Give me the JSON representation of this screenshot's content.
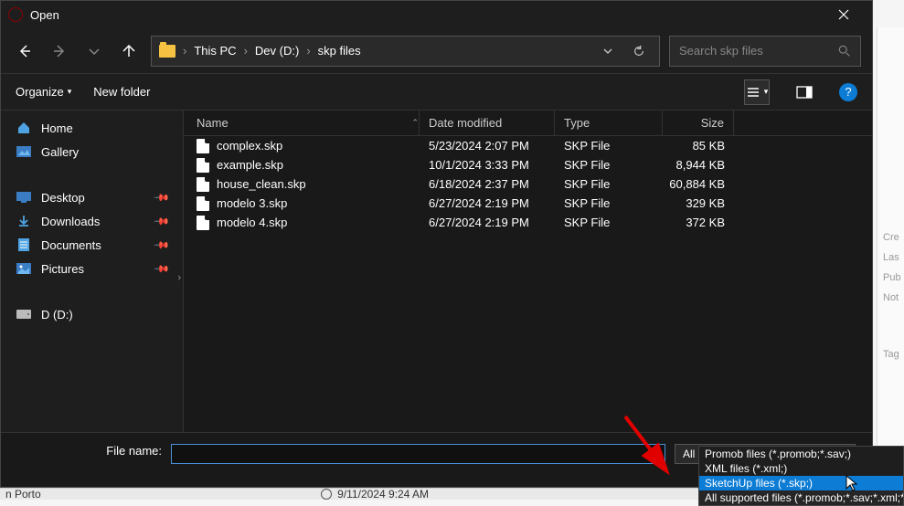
{
  "window": {
    "title": "Open"
  },
  "nav": {
    "breadcrumbs": [
      "This PC",
      "Dev (D:)",
      "skp files"
    ],
    "search_placeholder": "Search skp files"
  },
  "toolbar": {
    "organize": "Organize",
    "new_folder": "New folder"
  },
  "sidebar": {
    "home": "Home",
    "gallery": "Gallery",
    "quick": [
      {
        "label": "Desktop"
      },
      {
        "label": "Downloads"
      },
      {
        "label": "Documents"
      },
      {
        "label": "Pictures"
      }
    ],
    "drive": "D (D:)"
  },
  "columns": {
    "name": "Name",
    "date": "Date modified",
    "type": "Type",
    "size": "Size"
  },
  "files": [
    {
      "name": "complex.skp",
      "date": "5/23/2024 2:07 PM",
      "type": "SKP File",
      "size": "85 KB"
    },
    {
      "name": "example.skp",
      "date": "10/1/2024 3:33 PM",
      "type": "SKP File",
      "size": "8,944 KB"
    },
    {
      "name": "house_clean.skp",
      "date": "6/18/2024 2:37 PM",
      "type": "SKP File",
      "size": "60,884 KB"
    },
    {
      "name": "modelo 3.skp",
      "date": "6/27/2024 2:19 PM",
      "type": "SKP File",
      "size": "329 KB"
    },
    {
      "name": "modelo 4.skp",
      "date": "6/27/2024 2:19 PM",
      "type": "SKP File",
      "size": "372 KB"
    }
  ],
  "bottom": {
    "filename_label": "File name:",
    "filter_selected": "All supported files (*.promob;*.",
    "filter_options": [
      "Promob files (*.promob;*.sav;)",
      "XML files (*.xml;)",
      "SketchUp files (*.skp;)",
      "All supported files (*.promob;*.sav;*.xml;*.skp;)"
    ]
  },
  "taskbar": {
    "left_text": "n Porto",
    "datetime": "9/11/2024 9:24 AM"
  },
  "rightpanel": [
    "Cre",
    "Las",
    "Pub",
    "Not",
    "Tag"
  ]
}
